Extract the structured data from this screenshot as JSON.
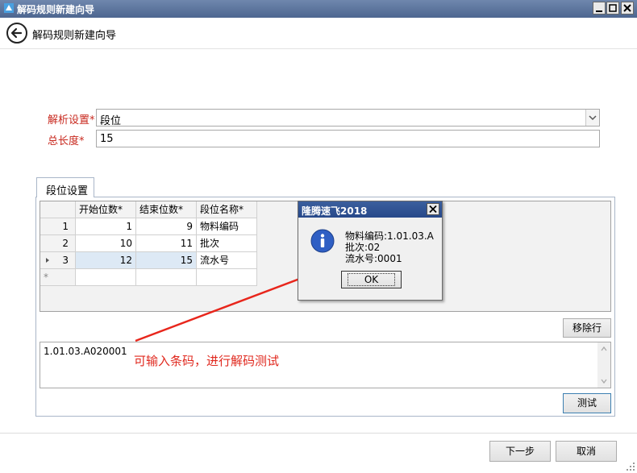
{
  "window": {
    "title": "解码规则新建向导",
    "minimize_glyph": "_",
    "maximize_glyph": "□",
    "close_glyph": "X"
  },
  "header": {
    "title": "解码规则新建向导",
    "back_icon": "back-arrow-icon"
  },
  "form": {
    "parse_label": "解析设置*",
    "parse_value": "段位",
    "length_label": "总长度*",
    "length_value": "15"
  },
  "tab": {
    "label": "段位设置"
  },
  "grid": {
    "columns": [
      "开始位数*",
      "结束位数*",
      "段位名称*"
    ],
    "rows": [
      {
        "index": "1",
        "start": "1",
        "end": "9",
        "name": "物料编码"
      },
      {
        "index": "2",
        "start": "10",
        "end": "11",
        "name": "批次"
      },
      {
        "index": "3",
        "start": "12",
        "end": "15",
        "name": "流水号"
      }
    ],
    "new_row_marker": "*"
  },
  "buttons": {
    "remove_row": "移除行",
    "test": "测试",
    "next": "下一步",
    "cancel": "取消"
  },
  "test_input": {
    "value": "1.01.03.A020001"
  },
  "annotation": "可输入条码，进行解码测试",
  "message_box": {
    "title": "隆腾速飞2018",
    "lines": [
      "物料编码:1.01.03.A",
      "批次:02",
      "流水号:0001"
    ],
    "ok": "OK",
    "icon": "info-icon"
  },
  "colors": {
    "title_bar": "#5a73a0",
    "required_label": "#c8281e",
    "annotation": "#e0281e",
    "selected_row": "#dde9f5"
  }
}
